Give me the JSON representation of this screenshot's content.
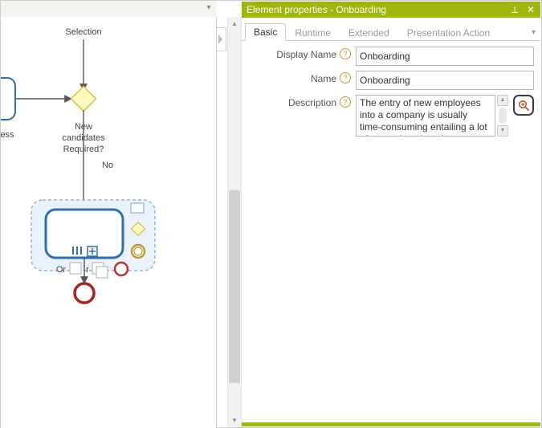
{
  "panel": {
    "title": "Element properties - Onboarding"
  },
  "tabs": {
    "basic": "Basic",
    "runtime": "Runtime",
    "extended": "Extended",
    "presentation_action": "Presentation Action"
  },
  "labels": {
    "display_name": "Display Name",
    "name": "Name",
    "description": "Description"
  },
  "values": {
    "display_name": "Onboarding",
    "name": "Onboarding",
    "description": "The entry of new employees into a company is usually time-consuming entailing a lot of manual work and"
  },
  "diagram": {
    "selection_label": "Selection",
    "gateway_question_l1": "New",
    "gateway_question_l2": "candidates",
    "gateway_question_l3": "Required?",
    "no_label": "No",
    "or_label": "Or",
    "r_label": "r",
    "left_fragment": "ess"
  }
}
